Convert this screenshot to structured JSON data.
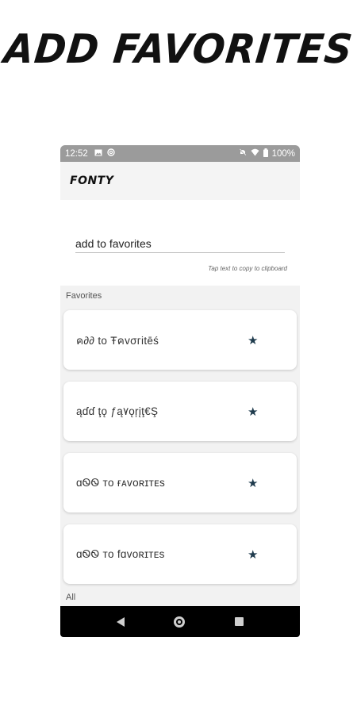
{
  "promo": {
    "headline": "ADD FAVORITES"
  },
  "status_bar": {
    "time": "12:52",
    "battery": "100%",
    "left_icons": [
      "image-icon",
      "at-icon"
    ],
    "right_icons": [
      "mute-icon",
      "wifi-icon",
      "battery-icon"
    ]
  },
  "app": {
    "title": "FONTY"
  },
  "input": {
    "value": "add to favorites",
    "hint": "Tap text to copy to clipboard"
  },
  "favorites": {
    "label": "Favorites",
    "items": [
      {
        "text": "ค∂∂ to Ŧคvσгitēś",
        "star_icon": "star-icon"
      },
      {
        "text": "ąɗɗ ţǫ ƒą۷ǫŗįţ€Ş",
        "star_icon": "star-icon"
      },
      {
        "text": "ɑᏫᏫ ᴛᴏ ғᴀᴠᴏʀɪᴛᴇs",
        "star_icon": "star-icon"
      },
      {
        "text": "ɑᏫᏫ ᴛᴏ fɑᴠᴏʀɪᴛᴇs",
        "star_icon": "star-icon"
      }
    ]
  },
  "all": {
    "label": "All"
  },
  "colors": {
    "star": "#1f3b4d",
    "status_bar": "#9b9b9b",
    "nav_bar": "#000000"
  }
}
